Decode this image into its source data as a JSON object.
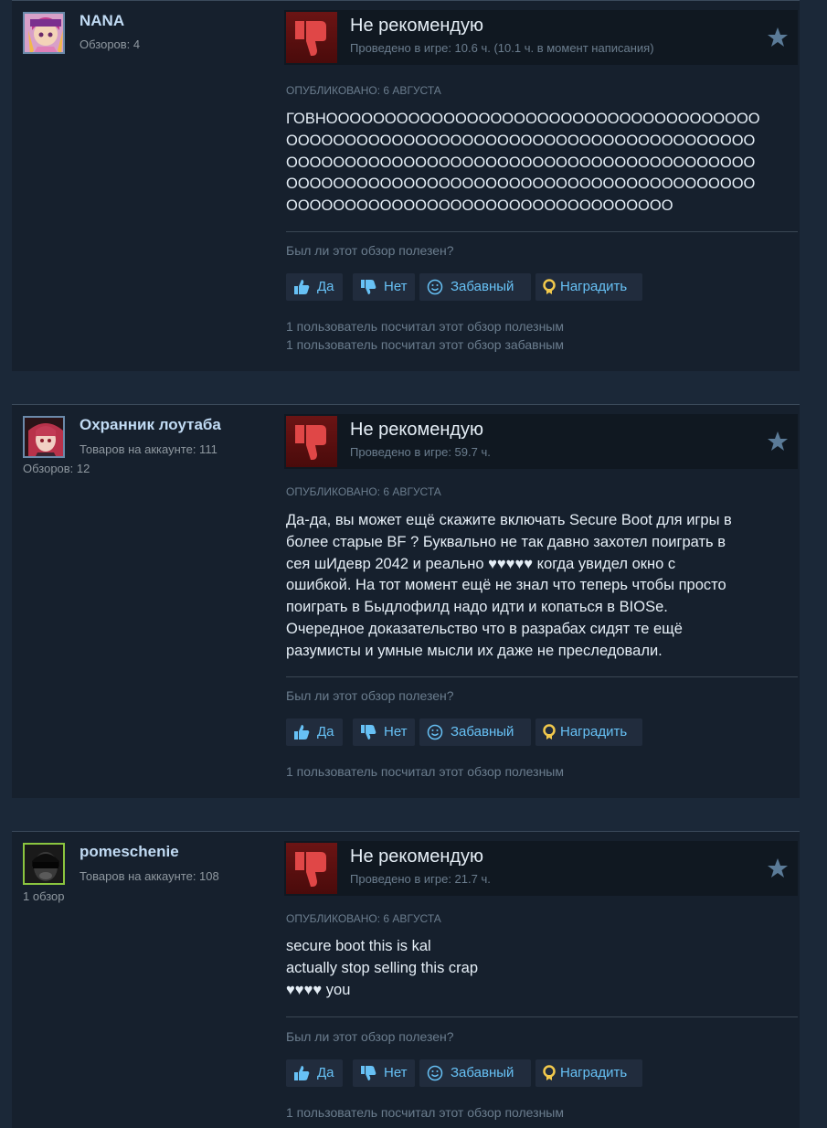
{
  "reviews": [
    {
      "author": {
        "name": "NANA",
        "stat1": "Обзоров: 4",
        "stat2": ""
      },
      "verdict": "Не рекомендую",
      "hours": "Проведено в игре: 10.6 ч. (10.1 ч. в момент написания)",
      "posted": "Опубликовано: 6 августа",
      "lines": [
        "ГОВНООООООООООООООООООООООООООООООООООООО",
        "ОООООООООООООООООООООООООООООООООООООООО",
        "ОООООООООООООООООООООООООООООООООООООООО",
        "ОООООООООООООООООООООООООООООООООООООООО",
        "ООООООООООООООООООООООООООООООООО"
      ],
      "helpful_question": "Был ли этот обзор полезен?",
      "buttons": {
        "yes": "Да",
        "no": "Нет",
        "funny": "Забавный",
        "award": "Наградить"
      },
      "stats": [
        "1 пользователь посчитал этот обзор полезным",
        "1 пользователь посчитал этот обзор забавным"
      ]
    },
    {
      "author": {
        "name": "Охранник лоутаба",
        "stat1": "Товаров на аккаунте: 111",
        "stat2": "Обзоров: 12"
      },
      "verdict": "Не рекомендую",
      "hours": "Проведено в игре: 59.7 ч.",
      "posted": "Опубликовано: 6 августа",
      "lines": [
        "Да-да, вы может ещё скажите включать Secure Boot для игры в",
        "более старые BF ? Буквально не так давно захотел поиграть в",
        "сея шИдевр 2042 и реально ♥♥♥♥♥ когда увидел окно с",
        "ошибкой. На тот момент ещё не знал что теперь чтобы просто",
        "поиграть в Быдлофилд надо идти и копаться в BIOSe.",
        "Очередное доказательство что в разрабах сидят те ещё",
        "разумисты и умные мысли их даже не преследовали."
      ],
      "helpful_question": "Был ли этот обзор полезен?",
      "buttons": {
        "yes": "Да",
        "no": "Нет",
        "funny": "Забавный",
        "award": "Наградить"
      },
      "stats": [
        "1 пользователь посчитал этот обзор полезным"
      ]
    },
    {
      "author": {
        "name": "pomeschenie",
        "stat1": "Товаров на аккаунте: 108",
        "stat2": "1 обзор"
      },
      "verdict": "Не рекомендую",
      "hours": "Проведено в игре: 21.7 ч.",
      "posted": "Опубликовано: 6 августа",
      "lines": [
        "secure boot this is kal",
        "actually stop selling this crap",
        "♥♥♥♥ you"
      ],
      "helpful_question": "Был ли этот обзор полезен?",
      "buttons": {
        "yes": "Да",
        "no": "Нет",
        "funny": "Забавный",
        "award": "Наградить"
      },
      "stats": [
        "1 пользователь посчитал этот обзор полезным"
      ]
    }
  ],
  "colors": {
    "background": "#1b2838",
    "card": "#16202d",
    "thumb_down": "#e04747",
    "link": "#67c1f5"
  },
  "icons": {
    "verdict": "thumbs-down-icon",
    "award": "star-icon",
    "yes": "thumbs-up-icon",
    "no": "thumbs-down-icon",
    "funny": "smiley-icon",
    "gift": "award-medal-icon"
  }
}
